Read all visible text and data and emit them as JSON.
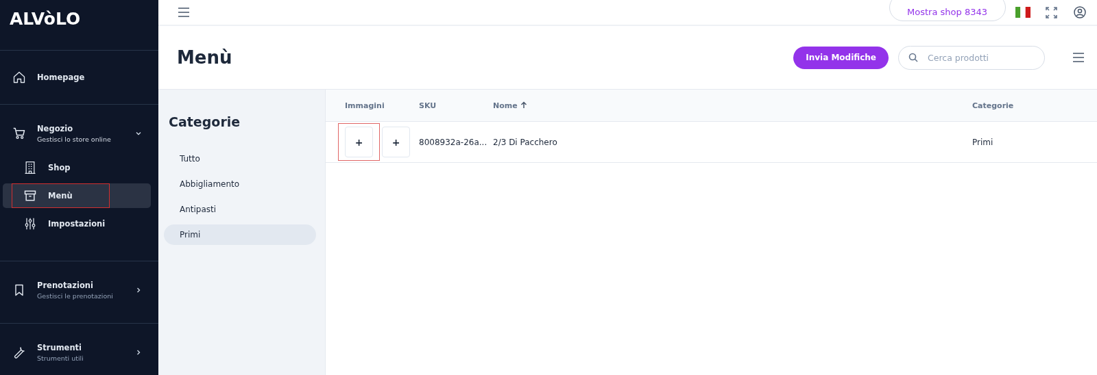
{
  "sidebar": {
    "logo": "ALVòLO",
    "sections": [
      {
        "kind": "link",
        "label": "Homepage"
      },
      {
        "kind": "group",
        "label": "Negozio",
        "subtitle": "Gestisci lo store online",
        "expanded": true,
        "children": [
          {
            "label": "Shop",
            "selected": false,
            "highlighted": false
          },
          {
            "label": "Menù",
            "selected": true,
            "highlighted": true
          },
          {
            "label": "Impostazioni",
            "selected": false,
            "highlighted": false
          }
        ]
      },
      {
        "kind": "group",
        "label": "Prenotazioni",
        "subtitle": "Gestisci le prenotazioni",
        "expanded": false
      },
      {
        "kind": "group",
        "label": "Strumenti",
        "subtitle": "Strumenti utili",
        "expanded": false
      }
    ]
  },
  "topbar": {
    "shop_button": "Mostra shop 8343"
  },
  "header": {
    "title": "Menù",
    "submit_button": "Invia Modifiche",
    "search": {
      "placeholder": "Cerca prodotti"
    }
  },
  "categories": {
    "title": "Categorie",
    "items": [
      {
        "label": "Tutto",
        "selected": false
      },
      {
        "label": "Abbigliamento",
        "selected": false
      },
      {
        "label": "Antipasti",
        "selected": false
      },
      {
        "label": "Primi",
        "selected": true
      }
    ]
  },
  "table": {
    "columns": [
      {
        "label": "Immagini",
        "sorted": false
      },
      {
        "label": "SKU",
        "sorted": false
      },
      {
        "label": "Nome",
        "sorted": true
      },
      {
        "label": "Categorie",
        "sorted": false
      }
    ],
    "rows": [
      {
        "image_buttons": [
          {
            "label": "+",
            "highlighted": true
          },
          {
            "label": "+",
            "highlighted": false
          }
        ],
        "sku": "8008932a-26a...",
        "name": "2/3 Di Pacchero",
        "category": "Primi"
      }
    ]
  }
}
